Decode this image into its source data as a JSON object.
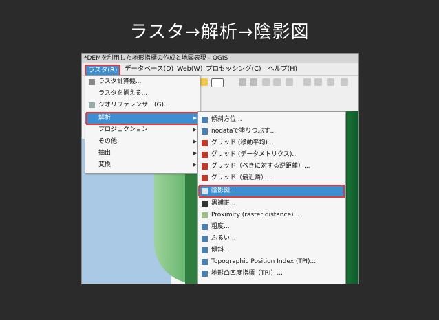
{
  "slide": {
    "title": "ラスタ→解析→陰影図"
  },
  "window": {
    "title": "*DEMを利用した地形指標の作成と地図表現 - QGIS"
  },
  "menubar": {
    "raster": "ラスタ(R)",
    "database": "データベース(D)",
    "web": "Web(W)",
    "processing": "プロセッシング(C)",
    "help": "ヘルプ(H)"
  },
  "raster_menu": {
    "items": [
      {
        "label": "ラスタ計算機..."
      },
      {
        "label": "ラスタを揃える..."
      },
      {
        "label": "ジオリファレンサー(G)..."
      },
      {
        "label": "解析"
      },
      {
        "label": "プロジェクション"
      },
      {
        "label": "その他"
      },
      {
        "label": "抽出"
      },
      {
        "label": "変換"
      }
    ]
  },
  "analysis_menu": {
    "items": [
      {
        "label": "傾斜方位..."
      },
      {
        "label": "nodataで塗りつぶす..."
      },
      {
        "label": "グリッド (移動平均)..."
      },
      {
        "label": "グリッド (データメトリクス)..."
      },
      {
        "label": "グリッド（べきに対する逆距離）..."
      },
      {
        "label": "グリッド（最近隣）..."
      },
      {
        "label": "陰影図..."
      },
      {
        "label": "黒補正..."
      },
      {
        "label": "Proximity (raster distance)..."
      },
      {
        "label": "粗度..."
      },
      {
        "label": "ふるい..."
      },
      {
        "label": "傾斜..."
      },
      {
        "label": "Topographic Position Index (TPI)..."
      },
      {
        "label": "地形凸凹度指標（TRI）..."
      }
    ]
  },
  "colors": {
    "highlight": "#3d8fd1",
    "annotation": "#e53935"
  }
}
